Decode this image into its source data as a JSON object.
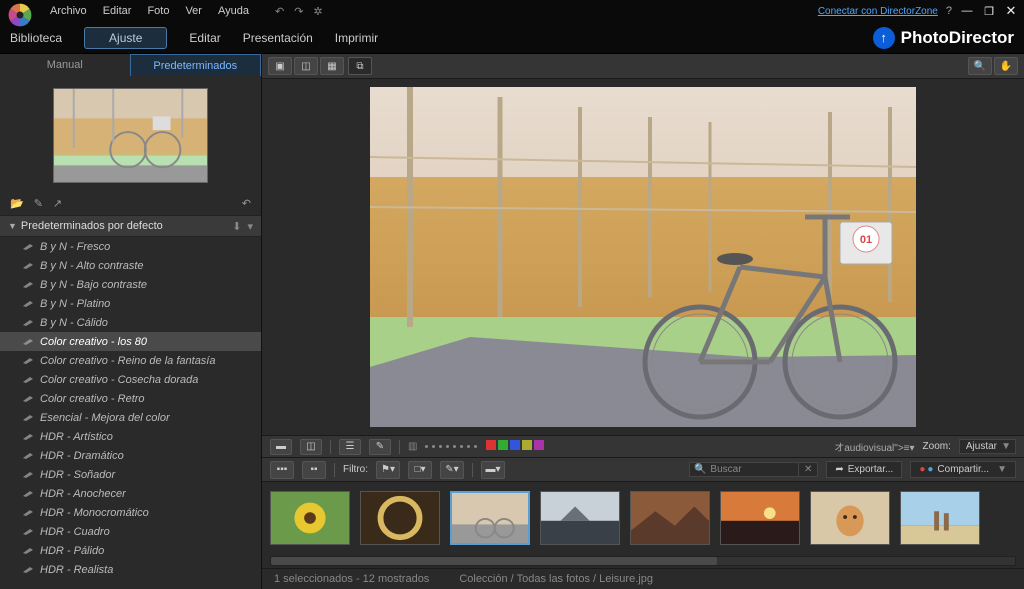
{
  "menu": {
    "archivo": "Archivo",
    "editar": "Editar",
    "foto": "Foto",
    "ver": "Ver",
    "ayuda": "Ayuda"
  },
  "titlebar": {
    "connect": "Conectar con DirectorZone"
  },
  "topbar": {
    "biblioteca": "Biblioteca",
    "ajuste": "Ajuste",
    "editar": "Editar",
    "presentacion": "Presentación",
    "imprimir": "Imprimir",
    "brand": "PhotoDirector"
  },
  "sidebar": {
    "tab_manual": "Manual",
    "tab_predeterminados": "Predeterminados",
    "header": "Predeterminados por defecto",
    "presets": [
      "B y N - Fresco",
      "B y N - Alto contraste",
      "B y N - Bajo contraste",
      "B y N - Platino",
      "B y N - Cálido",
      "Color creativo - los 80",
      "Color creativo - Reino de la fantasía",
      "Color creativo - Cosecha dorada",
      "Color creativo - Retro",
      "Esencial - Mejora del color",
      "HDR - Artístico",
      "HDR - Dramático",
      "HDR - Soñador",
      "HDR - Anochecer",
      "HDR - Monocromático",
      "HDR - Cuadro",
      "HDR - Pálido",
      "HDR - Realista"
    ],
    "selected_index": 5
  },
  "below": {
    "zoom_label": "Zoom:",
    "zoom_value": "Ajustar"
  },
  "filter": {
    "label": "Filtro:",
    "search_placeholder": "Buscar",
    "export": "Exportar...",
    "share": "Compartir..."
  },
  "colors": [
    "#d33",
    "#3a3",
    "#35d",
    "#aa3",
    "#a3a"
  ],
  "status": {
    "selection": "1 seleccionados - 12 mostrados",
    "path": "Colección / Todas las fotos / Leisure.jpg"
  }
}
